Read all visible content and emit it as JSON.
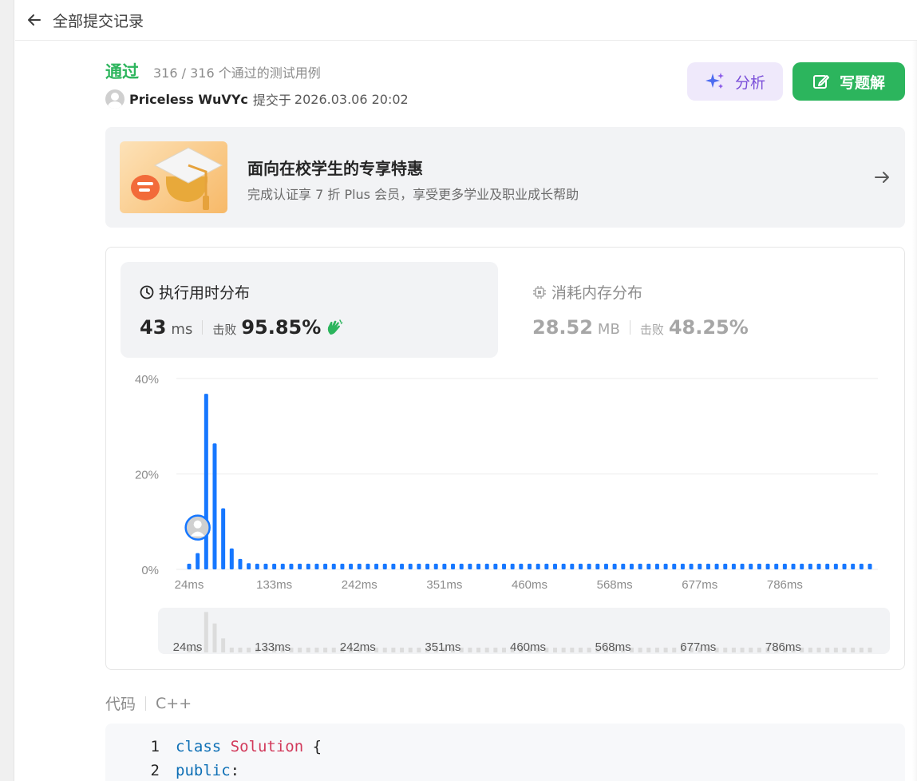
{
  "header": {
    "title": "全部提交记录"
  },
  "submission": {
    "status": "通过",
    "tests_text": "316 / 316 个通过的测试用例",
    "username": "Priceless WuVYc",
    "submit_prefix": "提交于",
    "submit_time": "2026.03.06 20:02"
  },
  "actions": {
    "analyze_label": "分析",
    "write_label": "写题解"
  },
  "promo": {
    "title": "面向在校学生的专享特惠",
    "subtitle": "完成认证享 7 折 Plus 会员，享受更多学业及职业成长帮助"
  },
  "performance": {
    "runtime": {
      "title": "执行用时分布",
      "value": "43",
      "unit": "ms",
      "beat_label": "击败",
      "beat_percent": "95.85%"
    },
    "memory": {
      "title": "消耗内存分布",
      "value": "28.52",
      "unit": "MB",
      "beat_label": "击败",
      "beat_percent": "48.25%"
    }
  },
  "chart_data": {
    "type": "bar",
    "title": "",
    "xlabel": "",
    "ylabel": "",
    "ylim": [
      0,
      40
    ],
    "yticks": [
      "0%",
      "20%",
      "40%"
    ],
    "xticks": [
      "24ms",
      "133ms",
      "242ms",
      "351ms",
      "460ms",
      "568ms",
      "677ms",
      "786ms"
    ],
    "navigator_ticks": [
      "24ms",
      "133ms",
      "242ms",
      "351ms",
      "460ms",
      "568ms",
      "677ms",
      "786ms"
    ],
    "user_runtime_bar_index": 1,
    "values": [
      1.2,
      3.4,
      36.8,
      26.4,
      12.8,
      4.4,
      2.2,
      1.3,
      1.2,
      1.2,
      1.2,
      1.2,
      1.2,
      1.2,
      1.2,
      1.2,
      1.2,
      1.2,
      1.2,
      1.2,
      1.2,
      1.2,
      1.2,
      1.2,
      1.2,
      1.2,
      1.2,
      1.2,
      1.2,
      1.2,
      1.2,
      1.2,
      1.2,
      1.2,
      1.2,
      1.2,
      1.2,
      1.2,
      1.2,
      1.2,
      1.2,
      1.2,
      1.2,
      1.2,
      1.2,
      1.2,
      1.2,
      1.2,
      1.2,
      1.2,
      1.2,
      1.2,
      1.2,
      1.2,
      1.2,
      1.2,
      1.2,
      1.2,
      1.2,
      1.2,
      1.2,
      1.2,
      1.2,
      1.2,
      1.2,
      1.2,
      1.2,
      1.2,
      1.2,
      1.2,
      1.2,
      1.2,
      1.2,
      1.2,
      1.2,
      1.2,
      1.2,
      1.2,
      1.2,
      1.2,
      1.2
    ],
    "colors": {
      "bar": "#1677ff",
      "navigator_bar": "#dcdcdc",
      "grid": "#ebebeb",
      "tick": "#8c8c8c"
    }
  },
  "code": {
    "label": "代码",
    "language": "C++",
    "lines": [
      {
        "num": "1",
        "tokens": [
          {
            "t": "class",
            "c": "kw"
          },
          {
            "t": " ",
            "c": "plain"
          },
          {
            "t": "Solution",
            "c": "cls"
          },
          {
            "t": " {",
            "c": "plain"
          }
        ]
      },
      {
        "num": "2",
        "tokens": [
          {
            "t": "public",
            "c": "kw"
          },
          {
            "t": ":",
            "c": "plain"
          }
        ]
      }
    ]
  }
}
